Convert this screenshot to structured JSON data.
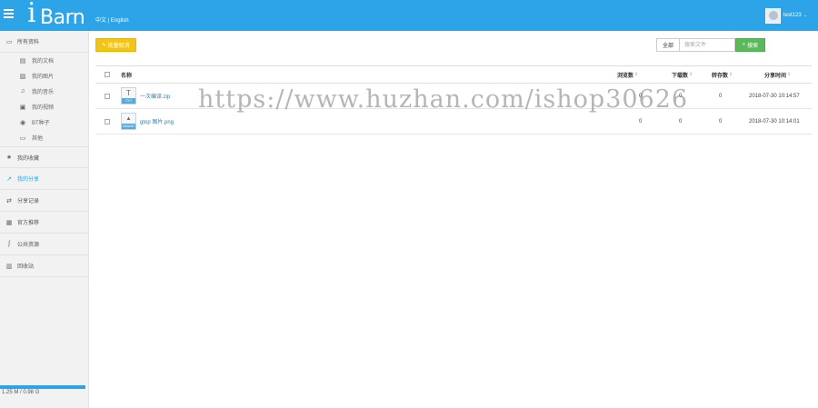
{
  "header": {
    "logo_initial": "i",
    "logo_rest": "Barn",
    "lang_zh": "中文",
    "lang_sep": " | ",
    "lang_en": "English",
    "username": "test123",
    "caret": "⌄"
  },
  "sidebar": {
    "all_files": "所有资料",
    "sub_items": [
      {
        "label": "我的文档",
        "icon": "document-icon",
        "glyph": "▤"
      },
      {
        "label": "我的图片",
        "icon": "image-icon",
        "glyph": "▨"
      },
      {
        "label": "我的音乐",
        "icon": "music-icon",
        "glyph": "♫"
      },
      {
        "label": "我的视频",
        "icon": "video-icon",
        "glyph": "▣"
      },
      {
        "label": "BT种子",
        "icon": "torrent-icon",
        "glyph": "◉"
      },
      {
        "label": "其他",
        "icon": "folder-icon",
        "glyph": "▭"
      }
    ],
    "items": [
      {
        "label": "我的收藏",
        "icon": "star-icon",
        "glyph": "★"
      },
      {
        "label": "我的分享",
        "icon": "share-icon",
        "glyph": "↗"
      },
      {
        "label": "分享记录",
        "icon": "exchange-icon",
        "glyph": "⇄"
      },
      {
        "label": "官方推荐",
        "icon": "gift-icon",
        "glyph": "▦"
      },
      {
        "label": "公共资源",
        "icon": "rss-icon",
        "glyph": "ʃ"
      },
      {
        "label": "回收站",
        "icon": "trash-icon",
        "glyph": "▥"
      }
    ],
    "quota_text": "1.25 M / 0.98 G",
    "quota_fraction": 0.99
  },
  "toolbar": {
    "upload_label": "批量取消",
    "search_scope": "全部",
    "search_placeholder": "搜索文件",
    "search_button": "搜索"
  },
  "table": {
    "headers": {
      "name": "名称",
      "views": "浏览数",
      "downloads": "下载数",
      "saves": "转存数",
      "share_time": "分享时间",
      "sort_glyph": "⇕"
    },
    "rows": [
      {
        "name": "一次编译.zip",
        "type": "TXT",
        "views": "0",
        "downloads": "0",
        "saves": "0",
        "time": "2018-07-30 10:14:57"
      },
      {
        "name": "gtop 图片.png",
        "type": "IMAGE",
        "views": "0",
        "downloads": "0",
        "saves": "0",
        "time": "2018-07-30 10:14:01"
      }
    ]
  },
  "watermark": "https://www.huzhan.com/ishop30626"
}
